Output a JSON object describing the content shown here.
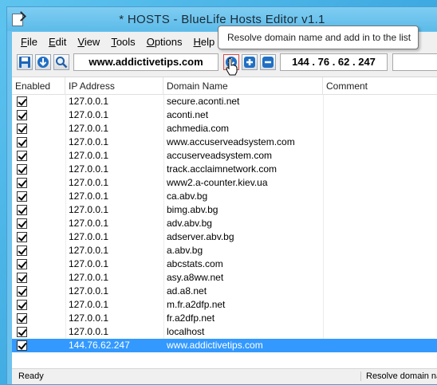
{
  "window": {
    "title": "* HOSTS - BlueLife Hosts Editor v1.1"
  },
  "menu": {
    "items": [
      {
        "label": "File",
        "accel": "F",
        "rest": "ile"
      },
      {
        "label": "Edit",
        "accel": "E",
        "rest": "dit"
      },
      {
        "label": "View",
        "accel": "V",
        "rest": "iew"
      },
      {
        "label": "Tools",
        "accel": "T",
        "rest": "ools"
      },
      {
        "label": "Options",
        "accel": "O",
        "rest": "ptions"
      },
      {
        "label": "Help",
        "accel": "H",
        "rest": "elp"
      }
    ]
  },
  "toolbar": {
    "domain_value": "www.addictivetips.com",
    "ip_value": "144 . 76 . 62 . 247",
    "comment_value": "",
    "icons": [
      "save-icon",
      "download-icon",
      "search-icon",
      "resolve-icon",
      "add-icon",
      "remove-icon"
    ]
  },
  "tooltip": {
    "text": "Resolve domain name and add in to the list"
  },
  "table": {
    "columns": [
      "Enabled",
      "IP Address",
      "Domain Name",
      "Comment"
    ],
    "rows": [
      {
        "enabled": true,
        "ip": "127.0.0.1",
        "domain": "secure.aconti.net",
        "comment": ""
      },
      {
        "enabled": true,
        "ip": "127.0.0.1",
        "domain": "aconti.net",
        "comment": ""
      },
      {
        "enabled": true,
        "ip": "127.0.0.1",
        "domain": "achmedia.com",
        "comment": ""
      },
      {
        "enabled": true,
        "ip": "127.0.0.1",
        "domain": "www.accuserveadsystem.com",
        "comment": ""
      },
      {
        "enabled": true,
        "ip": "127.0.0.1",
        "domain": "accuserveadsystem.com",
        "comment": ""
      },
      {
        "enabled": true,
        "ip": "127.0.0.1",
        "domain": "track.acclaimnetwork.com",
        "comment": ""
      },
      {
        "enabled": true,
        "ip": "127.0.0.1",
        "domain": "www2.a-counter.kiev.ua",
        "comment": ""
      },
      {
        "enabled": true,
        "ip": "127.0.0.1",
        "domain": "ca.abv.bg",
        "comment": ""
      },
      {
        "enabled": true,
        "ip": "127.0.0.1",
        "domain": "bimg.abv.bg",
        "comment": ""
      },
      {
        "enabled": true,
        "ip": "127.0.0.1",
        "domain": "adv.abv.bg",
        "comment": ""
      },
      {
        "enabled": true,
        "ip": "127.0.0.1",
        "domain": "adserver.abv.bg",
        "comment": ""
      },
      {
        "enabled": true,
        "ip": "127.0.0.1",
        "domain": "a.abv.bg",
        "comment": ""
      },
      {
        "enabled": true,
        "ip": "127.0.0.1",
        "domain": "abcstats.com",
        "comment": ""
      },
      {
        "enabled": true,
        "ip": "127.0.0.1",
        "domain": "asy.a8ww.net",
        "comment": ""
      },
      {
        "enabled": true,
        "ip": "127.0.0.1",
        "domain": "ad.a8.net",
        "comment": ""
      },
      {
        "enabled": true,
        "ip": "127.0.0.1",
        "domain": "m.fr.a2dfp.net",
        "comment": ""
      },
      {
        "enabled": true,
        "ip": "127.0.0.1",
        "domain": "fr.a2dfp.net",
        "comment": ""
      },
      {
        "enabled": true,
        "ip": "127.0.0.1",
        "domain": "localhost",
        "comment": ""
      },
      {
        "enabled": true,
        "ip": "144.76.62.247",
        "domain": "www.addictivetips.com",
        "comment": "",
        "selected": true
      }
    ]
  },
  "status": {
    "left": "Ready",
    "right": "Resolve domain name"
  },
  "colors": {
    "selection": "#3399ff",
    "window_frame": "#6cc3ee"
  }
}
